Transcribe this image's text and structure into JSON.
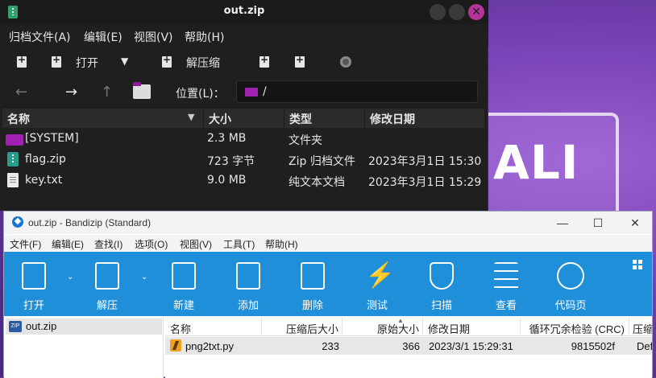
{
  "archive_manager": {
    "title": "out.zip",
    "menu": [
      "归档文件(A)",
      "编辑(E)",
      "视图(V)",
      "帮助(H)"
    ],
    "toolbar": {
      "open_label": "打开",
      "extract_label": "解压缩"
    },
    "nav": {
      "location_label": "位置(L)：",
      "location_path": "/"
    },
    "columns": [
      "名称",
      "大小",
      "类型",
      "修改日期"
    ],
    "rows": [
      {
        "name": "[SYSTEM]",
        "size": "2.3 MB",
        "type": "文件夹",
        "date": "",
        "icon": "folder-icon"
      },
      {
        "name": "flag.zip",
        "size": "723 字节",
        "type": "Zip 归档文件",
        "date": "2023年3月1日 15:30",
        "icon": "zip-icon"
      },
      {
        "name": "key.txt",
        "size": "9.0 MB",
        "type": "纯文本文档",
        "date": "2023年3月1日 15:29",
        "icon": "text-file-icon"
      }
    ]
  },
  "desktop": {
    "logo_text": "ALI"
  },
  "bandizip": {
    "title": "out.zip - Bandizip (Standard)",
    "menu": [
      "文件(F)",
      "编辑(E)",
      "查找(I)",
      "选项(O)",
      "视图(V)",
      "工具(T)",
      "帮助(H)"
    ],
    "toolbar": [
      "打开",
      "解压",
      "新建",
      "添加",
      "删除",
      "测试",
      "扫描",
      "查看",
      "代码页"
    ],
    "tree_item": "out.zip",
    "columns": [
      "名称",
      "压缩后大小",
      "原始大小",
      "修改日期",
      "循环冗余检验 (CRC)",
      "压缩"
    ],
    "rows": [
      {
        "name": "png2txt.py",
        "compressed": "233",
        "original": "366",
        "date": "2023/3/1 15:29:31",
        "crc": "9815502f",
        "method": "Def"
      }
    ]
  }
}
